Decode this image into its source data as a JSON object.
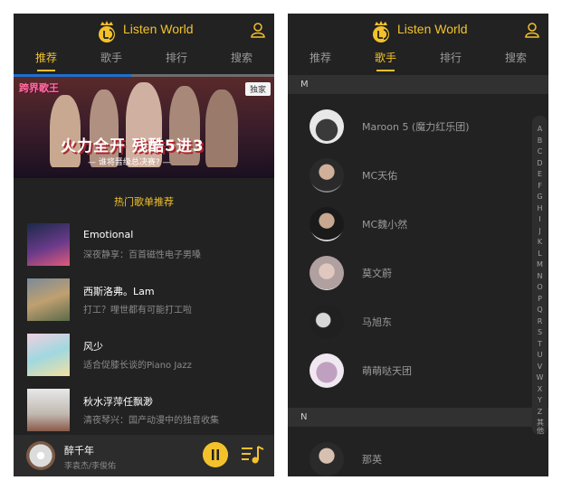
{
  "app": {
    "title": "Listen World",
    "accent_color": "#f3c22b",
    "background_color": "#222222"
  },
  "tabs": [
    "推荐",
    "歌手",
    "排行",
    "搜索"
  ],
  "left_screen": {
    "active_tab": "推荐",
    "banner": {
      "brand": "跨界歌王",
      "tag": "独家",
      "headline": "火力全开 残酷5进3",
      "subtitle": "— 谁将晋级总决赛? —",
      "slide_progress": 0.45
    },
    "section_title": "热门歌单推荐",
    "songs": [
      {
        "name": "Emotional",
        "desc": "深夜静享：百首磁性电子男嗓"
      },
      {
        "name": "西斯洛弗。Lam",
        "desc": "打工？哩世都有可能打工啦"
      },
      {
        "name": "风少",
        "desc": "适合促膝长谈的Piano Jazz"
      },
      {
        "name": "秋水浮萍任飘渺",
        "desc": "清夜琴兴：国产动漫中的独音收集"
      }
    ],
    "player": {
      "song": "醉千年",
      "artist": "李袁杰/李俊佑"
    }
  },
  "right_screen": {
    "active_tab": "歌手",
    "groups": [
      {
        "letter": "M",
        "singers": [
          "Maroon 5 (魔力红乐团)",
          "MC天佑",
          "MC魏小然",
          "莫文蔚",
          "马旭东",
          "萌萌哒天团"
        ]
      },
      {
        "letter": "N",
        "singers": [
          "那英"
        ]
      }
    ],
    "alphabet": [
      "A",
      "B",
      "C",
      "D",
      "E",
      "F",
      "G",
      "H",
      "I",
      "J",
      "K",
      "L",
      "M",
      "N",
      "O",
      "P",
      "Q",
      "R",
      "S",
      "T",
      "U",
      "V",
      "W",
      "X",
      "Y",
      "Z",
      "其他"
    ]
  }
}
